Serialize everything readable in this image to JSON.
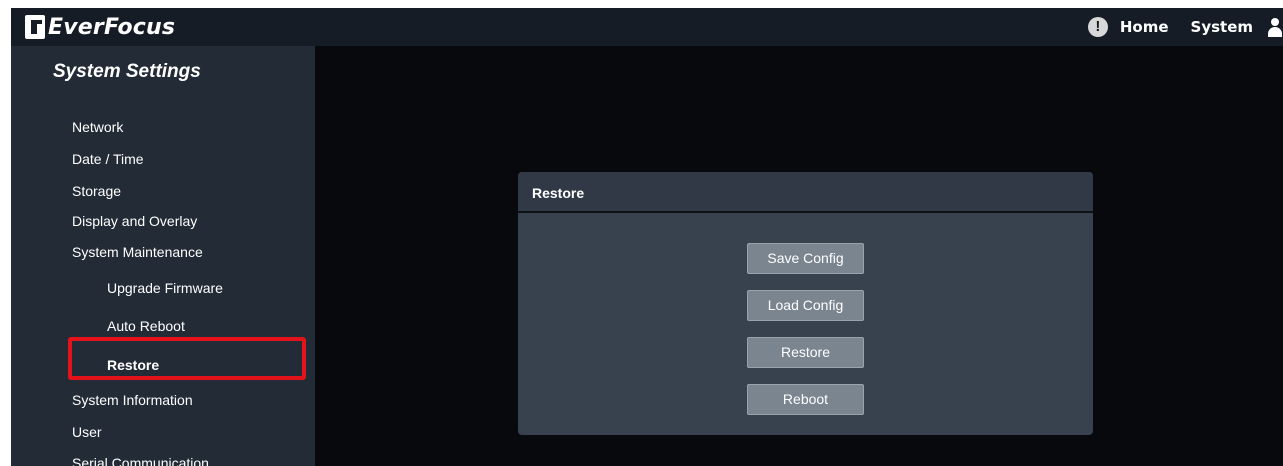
{
  "header": {
    "brand": "EverFocus",
    "nav": {
      "home": "Home",
      "system": "System"
    },
    "alert_glyph": "!",
    "icons": {
      "alert": "alert-circle-icon",
      "user": "user-icon",
      "logo": "everfocus-logo-icon"
    }
  },
  "sidebar": {
    "title": "System Settings",
    "items": [
      {
        "label": "Network"
      },
      {
        "label": "Date / Time"
      },
      {
        "label": "Storage"
      },
      {
        "label": "Display and Overlay"
      },
      {
        "label": "System Maintenance"
      },
      {
        "label": "Upgrade Firmware"
      },
      {
        "label": "Auto Reboot"
      },
      {
        "label": "Restore"
      },
      {
        "label": "System Information"
      },
      {
        "label": "User"
      },
      {
        "label": "Serial Communication"
      }
    ],
    "active_item": "Restore",
    "highlight_color": "#e3121b"
  },
  "panel": {
    "title": "Restore",
    "buttons": [
      {
        "label": "Save Config"
      },
      {
        "label": "Load Config"
      },
      {
        "label": "Restore"
      },
      {
        "label": "Reboot"
      }
    ]
  },
  "colors": {
    "topbar": "#151c25",
    "sidebar": "#232b36",
    "content_bg": "#07090c",
    "panel": "#38424e",
    "button": "#7b8590"
  }
}
